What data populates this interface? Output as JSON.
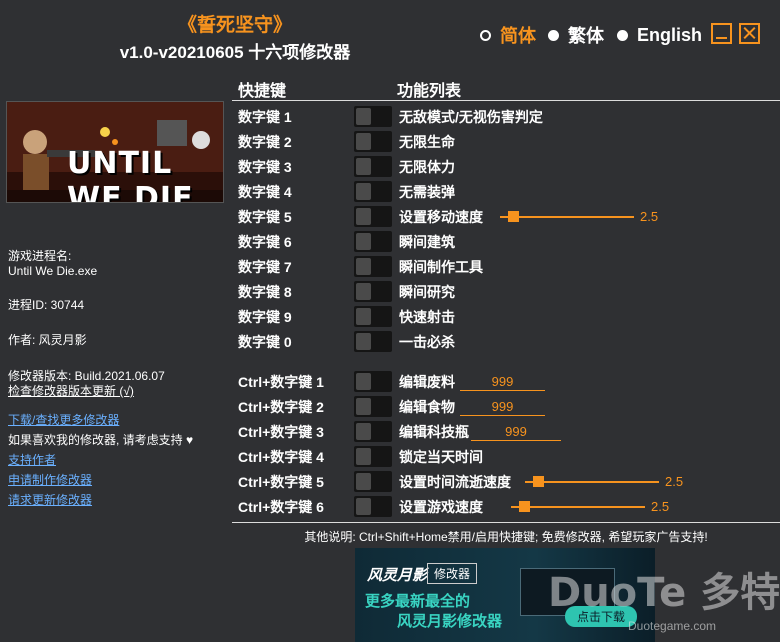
{
  "header": {
    "game_title": "《誓死坚守》",
    "version_title": "v1.0-v20210605 十六项修改器"
  },
  "languages": [
    {
      "label": "简体",
      "selected": true
    },
    {
      "label": "繁体",
      "selected": false
    },
    {
      "label": "English",
      "selected": false
    }
  ],
  "colors": {
    "accent": "#f7931e",
    "background": "#2f3033",
    "link": "#6ab0ff"
  },
  "banner": {
    "logo_text": "UNTIL WE DIE"
  },
  "info": {
    "process_label": "游戏进程名:",
    "process_name": "Until We Die.exe",
    "pid": "进程ID: 30744",
    "author": "作者: 风灵月影",
    "trainer_version": "修改器版本: Build.2021.06.07",
    "check_update": "检查修改器版本更新 (√)"
  },
  "links": {
    "download_more": "下载/查找更多修改器",
    "support_text": "如果喜欢我的修改器, 请考虑支持",
    "support_author": "支持作者",
    "request_trainer": "申请制作修改器",
    "request_update": "请求更新修改器"
  },
  "table": {
    "col_hotkey": "快捷键",
    "col_function": "功能列表",
    "rows": [
      {
        "key": "数字键 1",
        "name": "无敌模式/无视伤害判定"
      },
      {
        "key": "数字键 2",
        "name": "无限生命"
      },
      {
        "key": "数字键 3",
        "name": "无限体力"
      },
      {
        "key": "数字键 4",
        "name": "无需装弹"
      },
      {
        "key": "数字键 5",
        "name": "设置移动速度",
        "slider_value": "2.5",
        "slider_fraction": 0.1
      },
      {
        "key": "数字键 6",
        "name": "瞬间建筑"
      },
      {
        "key": "数字键 7",
        "name": "瞬间制作工具"
      },
      {
        "key": "数字键 8",
        "name": "瞬间研究"
      },
      {
        "key": "数字键 9",
        "name": "快速射击"
      },
      {
        "key": "数字键 0",
        "name": "一击必杀"
      },
      {
        "key": "Ctrl+数字键 1",
        "name": "编辑废料",
        "input_value": "999"
      },
      {
        "key": "Ctrl+数字键 2",
        "name": "编辑食物",
        "input_value": "999"
      },
      {
        "key": "Ctrl+数字键 3",
        "name": "编辑科技瓶",
        "input_value": "999"
      },
      {
        "key": "Ctrl+数字键 4",
        "name": "锁定当天时间"
      },
      {
        "key": "Ctrl+数字键 5",
        "name": "设置时间流逝速度",
        "slider_value": "2.5",
        "slider_fraction": 0.1
      },
      {
        "key": "Ctrl+数字键 6",
        "name": "设置游戏速度",
        "slider_value": "2.5",
        "slider_fraction": 0.1
      }
    ]
  },
  "footer_note": "其他说明: Ctrl+Shift+Home禁用/启用快捷键; 免费修改器, 希望玩家广告支持!",
  "ad": {
    "brand": "风灵月影",
    "tag": "修改器",
    "line1": "更多最新最全的",
    "line2": "风灵月影修改器",
    "button": "点击下载",
    "watermark": "DuoTe 多特",
    "watermark_url": "Duotegame.com"
  }
}
